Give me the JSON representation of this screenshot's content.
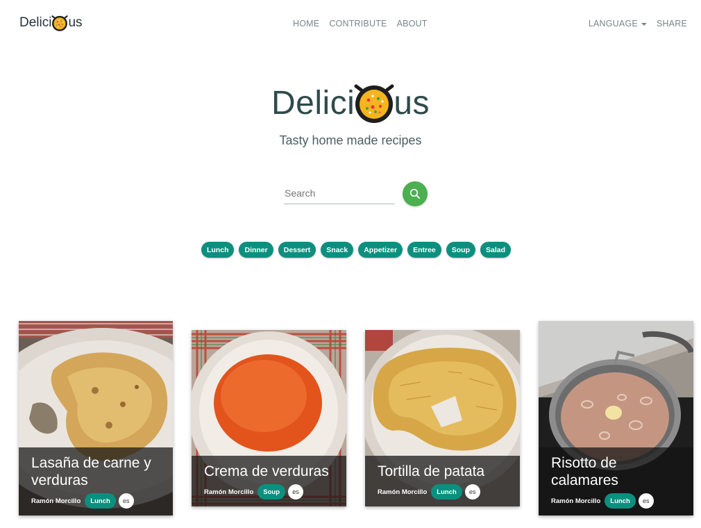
{
  "nav": {
    "brand_left": "Delici",
    "brand_right": "us",
    "links": [
      "HOME",
      "CONTRIBUTE",
      "ABOUT"
    ],
    "language": "LANGUAGE",
    "share": "SHARE"
  },
  "hero": {
    "title_left": "Delici",
    "title_right": "us",
    "subtitle": "Tasty home made recipes"
  },
  "search": {
    "placeholder": "Search"
  },
  "categories": [
    "Lunch",
    "Dinner",
    "Dessert",
    "Snack",
    "Appetizer",
    "Entree",
    "Soup",
    "Salad"
  ],
  "recipes": [
    {
      "title": "Lasaña de carne y verduras",
      "author": "Ramón Morcillo",
      "category": "Lunch",
      "lang": "es"
    },
    {
      "title": "Crema de verduras",
      "author": "Ramón Morcillo",
      "category": "Soup",
      "lang": "es"
    },
    {
      "title": "Tortilla de patata",
      "author": "Ramón Morcillo",
      "category": "Lunch",
      "lang": "es"
    },
    {
      "title": "Risotto de calamares",
      "author": "Ramón Morcillo",
      "category": "Lunch",
      "lang": "es"
    }
  ],
  "colors": {
    "accent_teal": "#0d8f7f",
    "search_button": "#4caf50",
    "title_text": "#2f4a4a"
  }
}
